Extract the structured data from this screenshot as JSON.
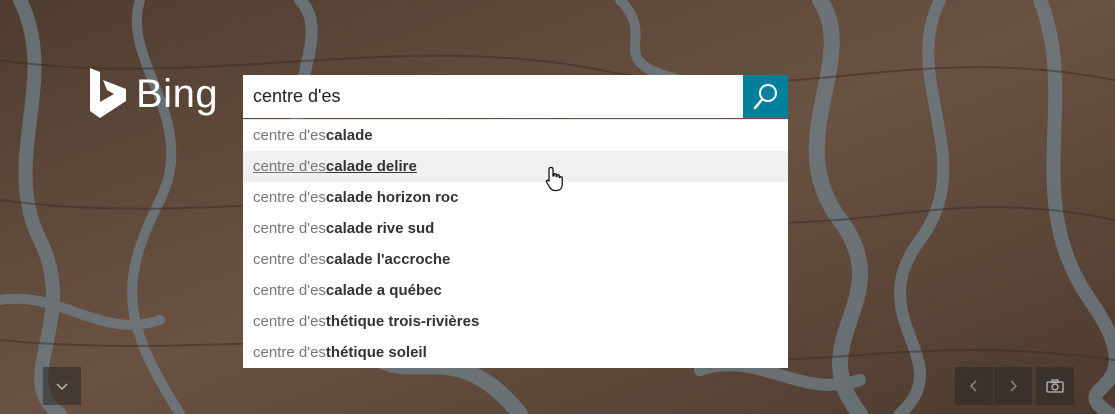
{
  "logo": {
    "text": "Bing"
  },
  "search": {
    "value": "centre d'es"
  },
  "suggestions": [
    {
      "prefix": "centre d'es",
      "completion": "calade"
    },
    {
      "prefix": "centre d'es",
      "completion": "calade delire"
    },
    {
      "prefix": "centre d'es",
      "completion": "calade horizon roc"
    },
    {
      "prefix": "centre d'es",
      "completion": "calade rive sud"
    },
    {
      "prefix": "centre d'es",
      "completion": "calade l'accroche"
    },
    {
      "prefix": "centre d'es",
      "completion": "calade a québec"
    },
    {
      "prefix": "centre d'es",
      "completion": "thétique trois-rivières"
    },
    {
      "prefix": "centre d'es",
      "completion": "thétique soleil"
    }
  ],
  "colors": {
    "accent": "#00809d"
  }
}
